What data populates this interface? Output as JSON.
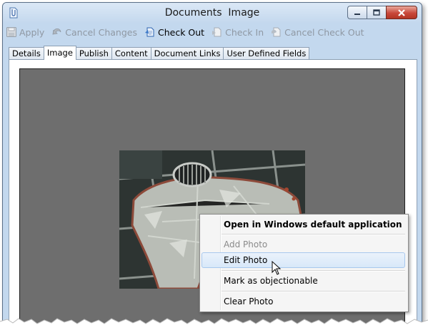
{
  "window": {
    "title": "Documents  Image",
    "icon": "document-paperclip-icon",
    "controls": [
      "minimize-icon",
      "maximize-icon",
      "close-icon"
    ]
  },
  "toolbar": {
    "apply": "Apply",
    "cancel_changes": "Cancel Changes",
    "check_out": "Check Out",
    "check_in": "Check In",
    "cancel_check_out": "Cancel Check Out"
  },
  "tabs": [
    "Details",
    "Image",
    "Publish",
    "Content",
    "Document Links",
    "User Defined Fields"
  ],
  "active_tab": "Image",
  "context_menu": {
    "open_default": "Open in Windows default application",
    "add_photo": "Add Photo",
    "edit_photo": "Edit Photo",
    "mark_objectionable": "Mark as objectionable",
    "clear_photo": "Clear Photo"
  },
  "colors": {
    "image_background": "#6e6e6e",
    "menu_highlight": "#d8e8f9",
    "close_button": "#c8483a"
  }
}
